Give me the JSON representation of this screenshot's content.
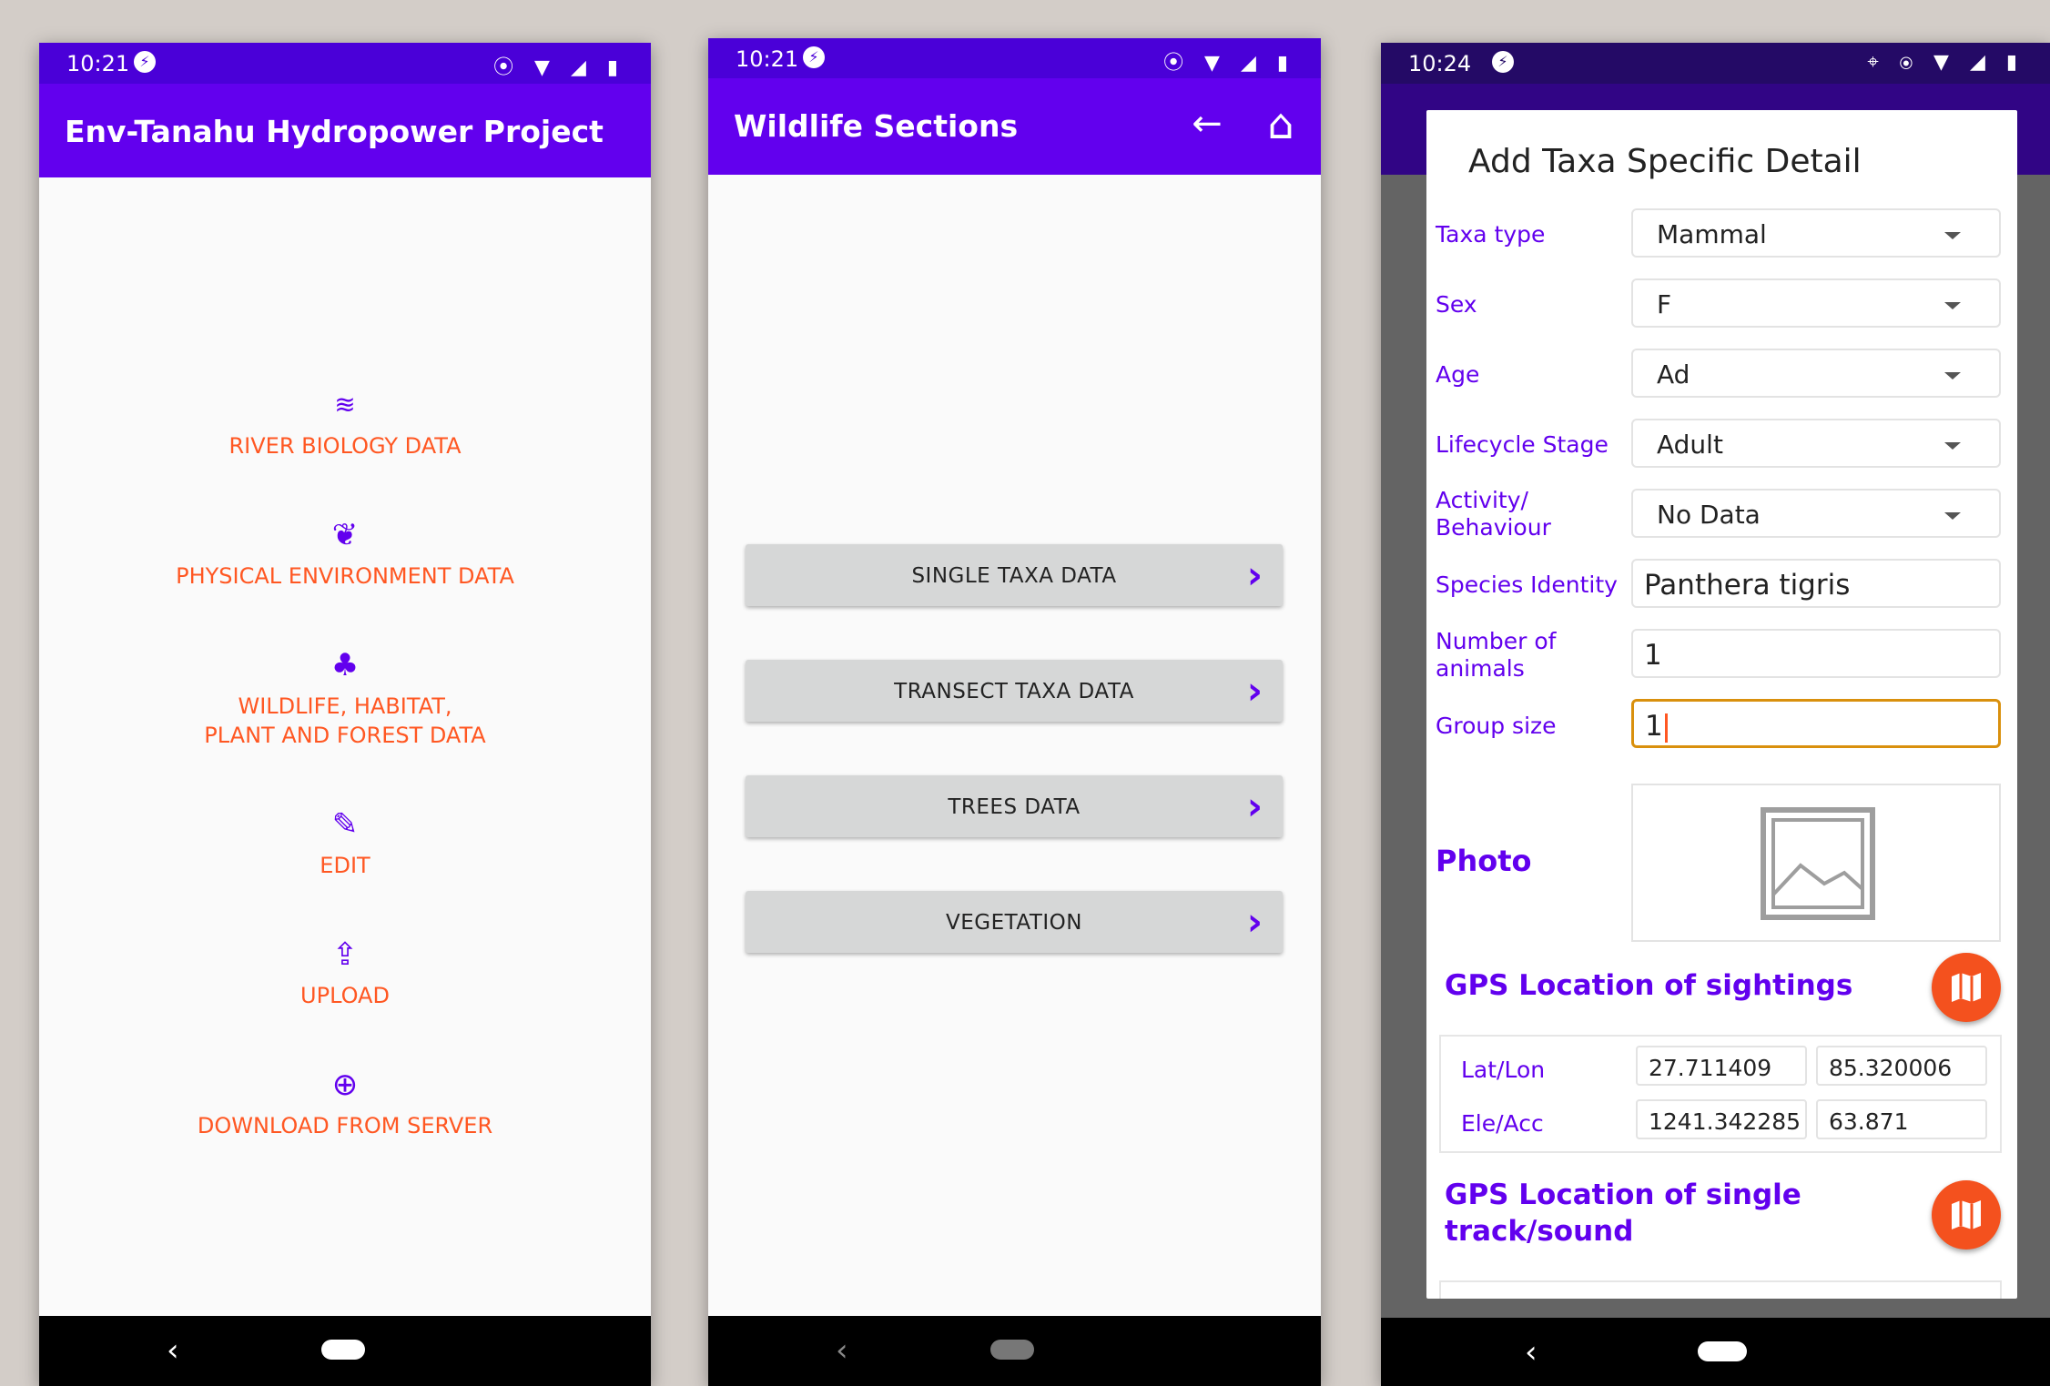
{
  "screen1": {
    "status": {
      "time": "10:21",
      "icons": "⦿ ▼ ◢ ▮"
    },
    "title": "Env-Tanahu Hydropower Project",
    "menu": [
      {
        "icon": "≋",
        "label1": "RIVER BIOLOGY DATA",
        "label2": ""
      },
      {
        "icon": "❦",
        "label1": "PHYSICAL ENVIRONMENT DATA",
        "label2": ""
      },
      {
        "icon": "♣",
        "label1": "WILDLIFE, HABITAT,",
        "label2": "PLANT AND FOREST DATA"
      },
      {
        "icon": "✎",
        "label1": "EDIT",
        "label2": ""
      },
      {
        "icon": "⇪",
        "label1": "UPLOAD",
        "label2": ""
      },
      {
        "icon": "⊕",
        "label1": "DOWNLOAD FROM SERVER",
        "label2": ""
      }
    ],
    "nav": {
      "back": "‹"
    }
  },
  "screen2": {
    "status": {
      "time": "10:21",
      "icons": "⦿ ▼ ◢ ▮"
    },
    "title": "Wildlife Sections",
    "back_icon": "←",
    "home_icon": "⌂",
    "buttons": [
      "SINGLE TAXA DATA",
      "TRANSECT TAXA DATA",
      "TREES DATA",
      "VEGETATION"
    ],
    "chevron": "›",
    "nav": {
      "back": "‹"
    }
  },
  "screen3": {
    "status": {
      "time": "10:24",
      "icons": "⌖ ⦿ ▼ ◢ ▮"
    },
    "dialog_title": "Add Taxa Specific Detail",
    "fields": [
      {
        "label": "Taxa type",
        "value": "Mammal"
      },
      {
        "label": "Sex",
        "value": "F"
      },
      {
        "label": "Age",
        "value": "Ad"
      },
      {
        "label": "Lifecycle Stage",
        "value": "Adult"
      },
      {
        "label": "Activity/",
        "label2": "Behaviour",
        "value": "No Data"
      }
    ],
    "inputs": [
      {
        "label": "Species Identity",
        "value": "Panthera tigris"
      },
      {
        "label": "Number of",
        "label2": "animals",
        "value": "1"
      },
      {
        "label": "Group size",
        "value": "1"
      }
    ],
    "photo_label": "Photo",
    "gps_sightings": {
      "title": "GPS Location of sightings",
      "lat_lon_label": "Lat/Lon",
      "lat": "27.711409",
      "lon": "85.320006",
      "ele_acc_label": "Ele/Acc",
      "ele": "1241.342285",
      "acc": "63.871"
    },
    "gps_track": {
      "title1": "GPS Location of single",
      "title2": "track/sound"
    },
    "nav": {
      "back": "‹"
    }
  }
}
